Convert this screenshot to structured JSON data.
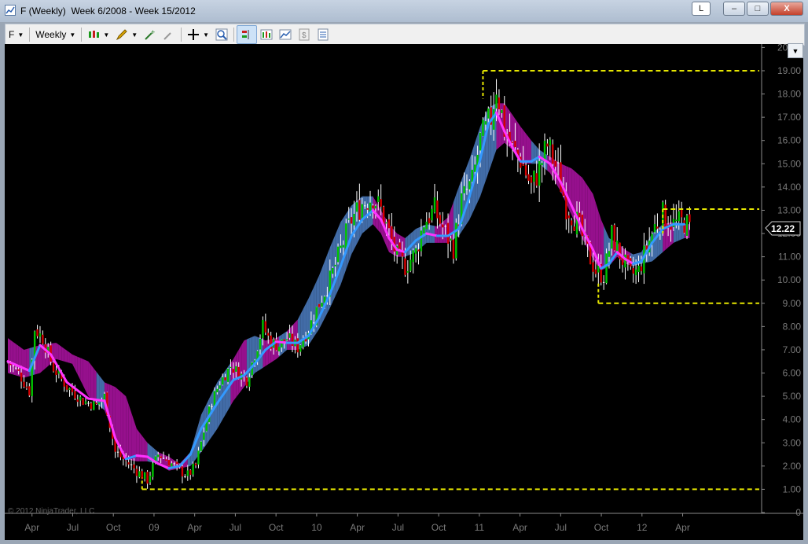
{
  "window": {
    "title": "F (Weekly)  Week 6/2008 - Week 15/2012",
    "btn_l": "L",
    "btn_min": "–",
    "btn_max": "□",
    "btn_close": "X"
  },
  "toolbar": {
    "instrument": "F",
    "period": "Weekly",
    "icons": [
      "candlestick-icon",
      "pencil-icon",
      "crosshair-add-icon",
      "crosshair-remove-icon",
      "crosshair-icon",
      "zoom-icon",
      "bar-style-icon",
      "data-box-icon",
      "indicators-icon",
      "strategies-icon",
      "properties-icon"
    ]
  },
  "chart_data": {
    "type": "candlestick",
    "symbol": "F",
    "period": "Weekly",
    "last_price": "12.22",
    "copyright": "© 2012 NinjaTrader, LLC",
    "ylim": [
      0,
      20
    ],
    "y_ticks": [
      "20.00",
      "19.00",
      "18.00",
      "17.00",
      "16.00",
      "15.00",
      "14.00",
      "13.00",
      "12.00",
      "11.00",
      "10.00",
      "9.00",
      "8.00",
      "7.00",
      "6.00",
      "5.00",
      "4.00",
      "3.00",
      "2.00",
      "1.00",
      "0"
    ],
    "x_ticks": [
      "Apr",
      "Jul",
      "Oct",
      "09",
      "Apr",
      "Jul",
      "Oct",
      "10",
      "Apr",
      "Jul",
      "Oct",
      "11",
      "Apr",
      "Jul",
      "Oct",
      "12",
      "Apr"
    ],
    "horizontal_levels": [
      {
        "level": 19.0,
        "from_week": 177,
        "to": "right"
      },
      {
        "level": 1.0,
        "from_week": 50,
        "to": "right"
      },
      {
        "level": 13.05,
        "from_week": 244,
        "to": "right"
      },
      {
        "level": 9.0,
        "from_week": 220,
        "to": "right"
      }
    ],
    "colors": {
      "background": "#000000",
      "up": "#00c400",
      "down": "#d40000",
      "doji": "#ffffff",
      "level_line": "#e6e600",
      "fast_ma": "#3399ff",
      "slow_ma": "#ff33ff",
      "band_fill_up": "#4d7fc4",
      "band_fill_down": "#b013a6"
    },
    "price_path": [
      [
        0,
        6.5
      ],
      [
        4,
        6.0
      ],
      [
        8,
        5.2
      ],
      [
        10,
        7.9
      ],
      [
        13,
        7.5
      ],
      [
        17,
        6.2
      ],
      [
        22,
        5.4
      ],
      [
        28,
        4.8
      ],
      [
        33,
        4.6
      ],
      [
        36,
        5.0
      ],
      [
        40,
        2.6
      ],
      [
        44,
        2.2
      ],
      [
        48,
        1.8
      ],
      [
        52,
        1.4
      ],
      [
        56,
        2.5
      ],
      [
        60,
        2.2
      ],
      [
        64,
        1.8
      ],
      [
        67,
        1.6
      ],
      [
        70,
        2.0
      ],
      [
        73,
        3.5
      ],
      [
        76,
        4.8
      ],
      [
        79,
        5.6
      ],
      [
        83,
        6.3
      ],
      [
        86,
        6.0
      ],
      [
        89,
        5.7
      ],
      [
        92,
        6.8
      ],
      [
        95,
        8.0
      ],
      [
        98,
        7.3
      ],
      [
        101,
        7.2
      ],
      [
        104,
        7.5
      ],
      [
        108,
        7.1
      ],
      [
        112,
        7.9
      ],
      [
        116,
        9.0
      ],
      [
        120,
        10.0
      ],
      [
        124,
        11.3
      ],
      [
        128,
        12.6
      ],
      [
        132,
        13.3
      ],
      [
        136,
        13.6
      ],
      [
        139,
        13.0
      ],
      [
        142,
        12.0
      ],
      [
        145,
        11.0
      ],
      [
        148,
        10.6
      ],
      [
        152,
        11.2
      ],
      [
        155,
        12.5
      ],
      [
        159,
        13.0
      ],
      [
        163,
        12.0
      ],
      [
        166,
        11.4
      ],
      [
        169,
        13.4
      ],
      [
        173,
        14.2
      ],
      [
        176,
        16.0
      ],
      [
        178,
        16.4
      ],
      [
        180,
        17.0
      ],
      [
        182,
        18.4
      ],
      [
        185,
        16.5
      ],
      [
        188,
        15.6
      ],
      [
        191,
        15.2
      ],
      [
        195,
        14.0
      ],
      [
        198,
        14.8
      ],
      [
        201,
        15.8
      ],
      [
        205,
        14.6
      ],
      [
        208,
        13.2
      ],
      [
        212,
        12.5
      ],
      [
        216,
        11.2
      ],
      [
        219,
        10.4
      ],
      [
        222,
        10.2
      ],
      [
        225,
        11.9
      ],
      [
        228,
        11.1
      ],
      [
        232,
        10.2
      ],
      [
        235,
        10.4
      ],
      [
        238,
        11.4
      ],
      [
        241,
        12.3
      ],
      [
        244,
        12.8
      ],
      [
        248,
        12.4
      ],
      [
        252,
        12.5
      ],
      [
        254,
        12.2
      ]
    ],
    "fast_ma_path": [
      [
        0,
        6.5
      ],
      [
        8,
        6.1
      ],
      [
        12,
        7.2
      ],
      [
        16,
        6.8
      ],
      [
        22,
        5.6
      ],
      [
        30,
        4.9
      ],
      [
        36,
        4.8
      ],
      [
        40,
        3.2
      ],
      [
        44,
        2.3
      ],
      [
        48,
        2.45
      ],
      [
        52,
        2.4
      ],
      [
        56,
        2.1
      ],
      [
        60,
        1.9
      ],
      [
        64,
        2.0
      ],
      [
        68,
        2.5
      ],
      [
        72,
        3.6
      ],
      [
        78,
        4.7
      ],
      [
        84,
        5.7
      ],
      [
        88,
        5.9
      ],
      [
        92,
        6.4
      ],
      [
        96,
        7.0
      ],
      [
        100,
        7.35
      ],
      [
        104,
        7.3
      ],
      [
        108,
        7.3
      ],
      [
        112,
        7.6
      ],
      [
        116,
        8.4
      ],
      [
        120,
        9.4
      ],
      [
        124,
        10.6
      ],
      [
        128,
        11.9
      ],
      [
        132,
        12.6
      ],
      [
        136,
        13.0
      ],
      [
        139,
        12.6
      ],
      [
        142,
        11.8
      ],
      [
        145,
        11.3
      ],
      [
        148,
        11.2
      ],
      [
        152,
        11.7
      ],
      [
        156,
        12.0
      ],
      [
        160,
        11.9
      ],
      [
        164,
        11.9
      ],
      [
        168,
        12.2
      ],
      [
        172,
        13.6
      ],
      [
        176,
        15.2
      ],
      [
        179,
        16.7
      ],
      [
        182,
        17.2
      ],
      [
        185,
        16.4
      ],
      [
        188,
        15.7
      ],
      [
        191,
        15.1
      ],
      [
        195,
        15.1
      ],
      [
        198,
        15.3
      ],
      [
        202,
        15.0
      ],
      [
        206,
        14.2
      ],
      [
        210,
        13.2
      ],
      [
        214,
        12.2
      ],
      [
        218,
        11.3
      ],
      [
        221,
        10.5
      ],
      [
        224,
        10.7
      ],
      [
        227,
        11.2
      ],
      [
        230,
        10.9
      ],
      [
        233,
        10.7
      ],
      [
        236,
        10.8
      ],
      [
        240,
        11.6
      ],
      [
        244,
        12.2
      ],
      [
        248,
        12.4
      ],
      [
        252,
        12.4
      ]
    ],
    "band_cloud": [
      [
        0,
        [
          6.0,
          7.5
        ]
      ],
      [
        6,
        [
          5.8,
          7.0
        ]
      ],
      [
        12,
        [
          6.0,
          7.2
        ]
      ],
      [
        18,
        [
          6.6,
          7.3
        ]
      ],
      [
        24,
        [
          6.4,
          6.8
        ]
      ],
      [
        30,
        [
          5.0,
          6.5
        ]
      ],
      [
        36,
        [
          4.4,
          5.6
        ]
      ],
      [
        40,
        [
          3.2,
          5.4
        ]
      ],
      [
        44,
        [
          2.3,
          5.0
        ]
      ],
      [
        48,
        [
          2.2,
          3.6
        ]
      ],
      [
        52,
        [
          2.2,
          3.0
        ]
      ],
      [
        56,
        [
          2.1,
          2.6
        ]
      ],
      [
        60,
        [
          1.8,
          2.4
        ]
      ],
      [
        64,
        [
          1.9,
          2.1
        ]
      ],
      [
        68,
        [
          2.0,
          2.6
        ]
      ],
      [
        72,
        [
          2.6,
          4.2
        ]
      ],
      [
        78,
        [
          3.6,
          5.6
        ]
      ],
      [
        84,
        [
          4.8,
          6.6
        ]
      ],
      [
        88,
        [
          5.4,
          7.4
        ]
      ],
      [
        92,
        [
          6.0,
          7.6
        ]
      ],
      [
        96,
        [
          6.3,
          7.4
        ]
      ],
      [
        100,
        [
          6.6,
          7.5
        ]
      ],
      [
        104,
        [
          7.0,
          7.8
        ]
      ],
      [
        108,
        [
          7.0,
          8.3
        ]
      ],
      [
        112,
        [
          7.2,
          9.2
        ]
      ],
      [
        116,
        [
          7.9,
          10.2
        ]
      ],
      [
        120,
        [
          8.8,
          11.4
        ]
      ],
      [
        124,
        [
          9.8,
          12.5
        ]
      ],
      [
        128,
        [
          11.1,
          13.2
        ]
      ],
      [
        132,
        [
          12.0,
          13.6
        ]
      ],
      [
        136,
        [
          12.4,
          13.6
        ]
      ],
      [
        139,
        [
          12.0,
          13.0
        ]
      ],
      [
        142,
        [
          11.2,
          12.4
        ]
      ],
      [
        145,
        [
          11.0,
          12.0
        ]
      ],
      [
        148,
        [
          11.0,
          11.8
        ]
      ],
      [
        152,
        [
          11.2,
          12.2
        ]
      ],
      [
        156,
        [
          11.6,
          12.4
        ]
      ],
      [
        160,
        [
          11.6,
          12.3
        ]
      ],
      [
        164,
        [
          11.6,
          12.7
        ]
      ],
      [
        168,
        [
          11.9,
          14.0
        ]
      ],
      [
        172,
        [
          12.6,
          15.2
        ]
      ],
      [
        176,
        [
          13.6,
          16.6
        ]
      ],
      [
        179,
        [
          14.6,
          17.4
        ]
      ],
      [
        182,
        [
          15.6,
          17.6
        ]
      ],
      [
        185,
        [
          15.9,
          17.6
        ]
      ],
      [
        188,
        [
          15.6,
          17.1
        ]
      ],
      [
        191,
        [
          15.0,
          16.6
        ]
      ],
      [
        195,
        [
          15.0,
          16.0
        ]
      ],
      [
        198,
        [
          15.0,
          15.6
        ]
      ],
      [
        202,
        [
          14.6,
          15.3
        ]
      ],
      [
        206,
        [
          13.8,
          15.0
        ]
      ],
      [
        210,
        [
          12.8,
          14.8
        ]
      ],
      [
        214,
        [
          11.8,
          14.4
        ]
      ],
      [
        218,
        [
          10.9,
          13.7
        ]
      ],
      [
        221,
        [
          10.4,
          12.6
        ]
      ],
      [
        224,
        [
          10.6,
          11.8
        ]
      ],
      [
        227,
        [
          11.0,
          11.6
        ]
      ],
      [
        230,
        [
          10.7,
          11.3
        ]
      ],
      [
        233,
        [
          10.6,
          11.1
        ]
      ],
      [
        236,
        [
          10.7,
          11.2
        ]
      ],
      [
        240,
        [
          10.8,
          12.0
        ]
      ],
      [
        244,
        [
          11.2,
          12.4
        ]
      ],
      [
        248,
        [
          11.6,
          12.5
        ]
      ],
      [
        252,
        [
          11.8,
          12.4
        ]
      ]
    ]
  }
}
